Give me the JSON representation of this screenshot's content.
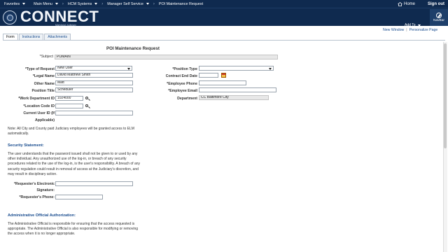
{
  "nav": {
    "favorites": "Favorites",
    "main_menu": "Main Menu",
    "crumb1": "HCM Systems",
    "crumb2": "Manager Self Service",
    "crumb3": "POI Maintenance Request",
    "home": "Home",
    "sign_out": "Sign out"
  },
  "banner": {
    "logo": "CONNECT",
    "logo_sub": "Maryland Judiciary",
    "add_to": "Add To",
    "navbar": "NavBar"
  },
  "links": {
    "new_window": "New Window",
    "sep": "|",
    "personalize": "Personalize Page"
  },
  "tabs": [
    "Form",
    "Instructions",
    "Attachments"
  ],
  "page_title": "POI Maintenance Request",
  "form": {
    "subject_label": "*Subject",
    "subject_value": "POMAIN",
    "type_of_request_label": "*Type of Request",
    "type_of_request_value": "New User",
    "position_type_label": "*Position Type",
    "position_type_value": "",
    "legal_name_label": "*Legal Name",
    "legal_name_value": "David Matthew Smith",
    "contract_end_date_label": "Contract End Date",
    "contract_end_date_value": "",
    "other_name_label": "Other Name",
    "other_name_value": "Matt",
    "employee_phone_label": "*Employee Phone",
    "employee_phone_value": "",
    "position_title_label": "Position Title",
    "position_title_value": "Scheduler",
    "employee_email_label": "*Employee Email",
    "employee_email_value": "",
    "work_dept_label": "*Work Department ID",
    "work_dept_value": "1024000",
    "department_label": "Department",
    "department_value": "CC Baltimore City",
    "location_code_label": "*Location Code ID",
    "location_code_value": "",
    "current_user_label_1": "Current User ID (If",
    "current_user_label_2": "Applicable)",
    "current_user_value": ""
  },
  "note": "Note: All City and County paid Judiciary employees will be granted access to ELM automatically.",
  "security": {
    "heading": "Security Statement:",
    "text": "The user understands that the password issued shall not be given to or used by any other individual. Any unauthorized use of the log-in, or breach of any security procedures related to the use of the log-in, is the user's responsibility. A breach of any security regulation could result in removal of access at the Judiciary's discretion, and may result in disciplinary action.",
    "signature_label_1": "*Requester's Electronic",
    "signature_label_2": "Signature:",
    "signature_value": "",
    "phone_label": "*Requester's Phone:",
    "phone_value": ""
  },
  "admin": {
    "heading": "Administrative Official Authorization:",
    "text": "The Administrative Official is responsible for ensuring that the access requested is appropriate. The Administrative Official is also responsible for modifying or removing the access when it is no longer appropriate."
  },
  "colors": {
    "nav_bg": "#0f2a4f",
    "link": "#1a4d8f"
  }
}
